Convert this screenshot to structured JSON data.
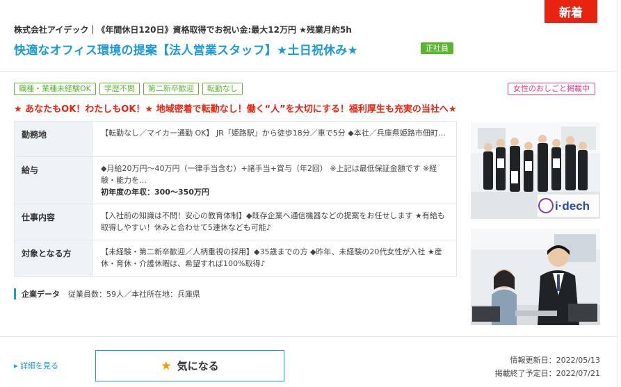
{
  "new_badge": "新着",
  "company_line": "株式会社アイデック｜《年間休日120日》資格取得でお祝い金:最大12万円 ★残業月約5h",
  "job_title": "快適なオフィス環境の提案【法人営業スタッフ】★土日祝休み★",
  "employment_type": "正社員",
  "tags": [
    "職種・業種未経験OK",
    "学歴不問",
    "第二新卒歓迎",
    "転勤なし"
  ],
  "women_tag": "女性のおしごと掲載中",
  "catch_copy": "★ あなたもOK！わたしもOK！★ 地域密着で転勤なし！働く“人”を大切にする！福利厚生も充実の当社へ★",
  "details": [
    {
      "label": "勤務地",
      "value": "【転勤なし／マイカー通勤 OK】 JR「姫路駅」から徒歩18分／車で5分 ◆本社／兵庫県姫路市佃町…",
      "extra": ""
    },
    {
      "label": "給与",
      "value": "◆月給20万円〜40万円（一律手当含む）+諸手当+賞与（年2回） ※上記は最低保証金額です ※経験・能力を…",
      "extra": "初年度の年収：300〜350万円"
    },
    {
      "label": "仕事内容",
      "value": "【入社前の知識は不問！安心の教育体制】◆既存企業へ通信機器などの提案をお任せします ★有給も取得しやすい！休みと合わせて5連休なども可能♪",
      "extra": ""
    },
    {
      "label": "対象となる方",
      "value": "【未経験・第二新卒歓迎／人柄重視の採用】◆35歳までの方 ◆昨年、未経験の20代女性が入社 ★産休・育休・介護休暇は、希望すれば100%取得♪",
      "extra": ""
    }
  ],
  "company_data": {
    "label": "企業データ",
    "value": "従業員数：59人／本社所在地：兵庫県"
  },
  "photo_logo": "i·dech",
  "detail_link": "▸ 詳細を見る",
  "favorite": {
    "label": "気になる",
    "icon": "star-icon"
  },
  "dates": {
    "updated": "情報更新日：2022/05/13",
    "end": "掲載終了予定日：2022/07/21"
  },
  "colors": {
    "accent": "#1a9ad6",
    "new": "#e8230f",
    "green": "#5cb531",
    "pink": "#e0428f",
    "star": "#f39800"
  }
}
